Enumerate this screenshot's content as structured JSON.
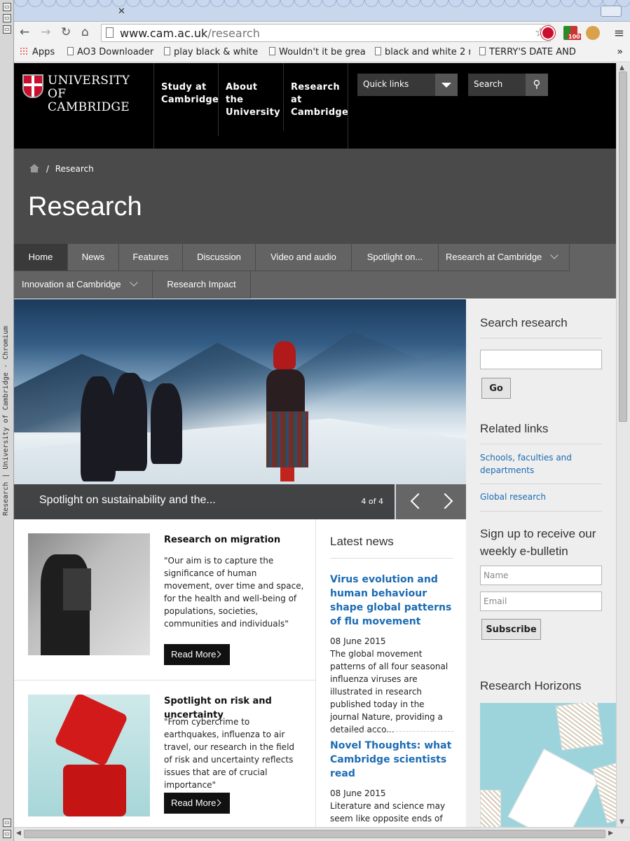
{
  "window": {
    "title": "Research | University of Cambridge - Chromium"
  },
  "browser": {
    "url_host": "www.cam.ac.uk",
    "url_path": "/research",
    "ext_badge": "100",
    "bookmarks": [
      {
        "label": "Apps"
      },
      {
        "label": "AO3 Downloader"
      },
      {
        "label": "play black & white"
      },
      {
        "label": "Wouldn't it be grea"
      },
      {
        "label": "black and white 2 r"
      },
      {
        "label": "TERRY'S DATE AND"
      }
    ],
    "more_bookmarks": "»"
  },
  "header": {
    "logo_line1": "UNIVERSITY OF",
    "logo_line2": "CAMBRIDGE",
    "nav": [
      {
        "label": "Study at Cambridge"
      },
      {
        "label": "About the University"
      },
      {
        "label": "Research at Cambridge"
      }
    ],
    "quick_links": "Quick links",
    "search_placeholder": "Search"
  },
  "breadcrumb": {
    "current": "Research",
    "separator": "/"
  },
  "page_title": "Research",
  "subnav": [
    {
      "label": "Home",
      "active": true
    },
    {
      "label": "News"
    },
    {
      "label": "Features"
    },
    {
      "label": "Discussion"
    },
    {
      "label": "Video and audio"
    },
    {
      "label": "Spotlight on..."
    },
    {
      "label": "Research at Cambridge"
    },
    {
      "label": "Innovation at Cambridge"
    },
    {
      "label": "Research Impact"
    }
  ],
  "hero": {
    "caption": "Spotlight on sustainability and the...",
    "counter": "4 of 4"
  },
  "features": [
    {
      "title": "Research on migration",
      "description": "\"Our aim is to capture the significance of human movement, over time and space, for the health and well-being of populations, societies, communities and individuals\"",
      "button": "Read More"
    },
    {
      "title": "Spotlight on risk and uncertainty",
      "description": "\"From cybercrime to earthquakes, influenza to air travel, our research in the field of risk and uncertainty reflects issues that are of crucial importance\"",
      "button": "Read More"
    }
  ],
  "latest_news": {
    "heading": "Latest news",
    "items": [
      {
        "title": "Virus evolution and human behaviour shape global patterns of flu movement",
        "date": "08 June 2015",
        "summary": "The global movement patterns of all four seasonal influenza viruses are illustrated in research published today in the journal Nature, providing a detailed acco..."
      },
      {
        "title": "Novel Thoughts: what Cambridge scientists read",
        "date": "08 June 2015",
        "summary": "Literature and science may seem like opposite ends of the"
      }
    ]
  },
  "sidebar": {
    "search_heading": "Search research",
    "go_button": "Go",
    "related_heading": "Related links",
    "links": [
      {
        "label": "Schools, faculties and departments"
      },
      {
        "label": "Global research"
      }
    ],
    "signup_heading": "Sign up to receive our weekly e-bulletin",
    "name_placeholder": "Name",
    "email_placeholder": "Email",
    "subscribe_button": "Subscribe",
    "horizons_heading": "Research Horizons"
  },
  "colors": {
    "link_blue": "#1b6bb3",
    "header_black": "#000000",
    "title_band": "#4a4a4a",
    "subnav_grey": "#636363"
  }
}
